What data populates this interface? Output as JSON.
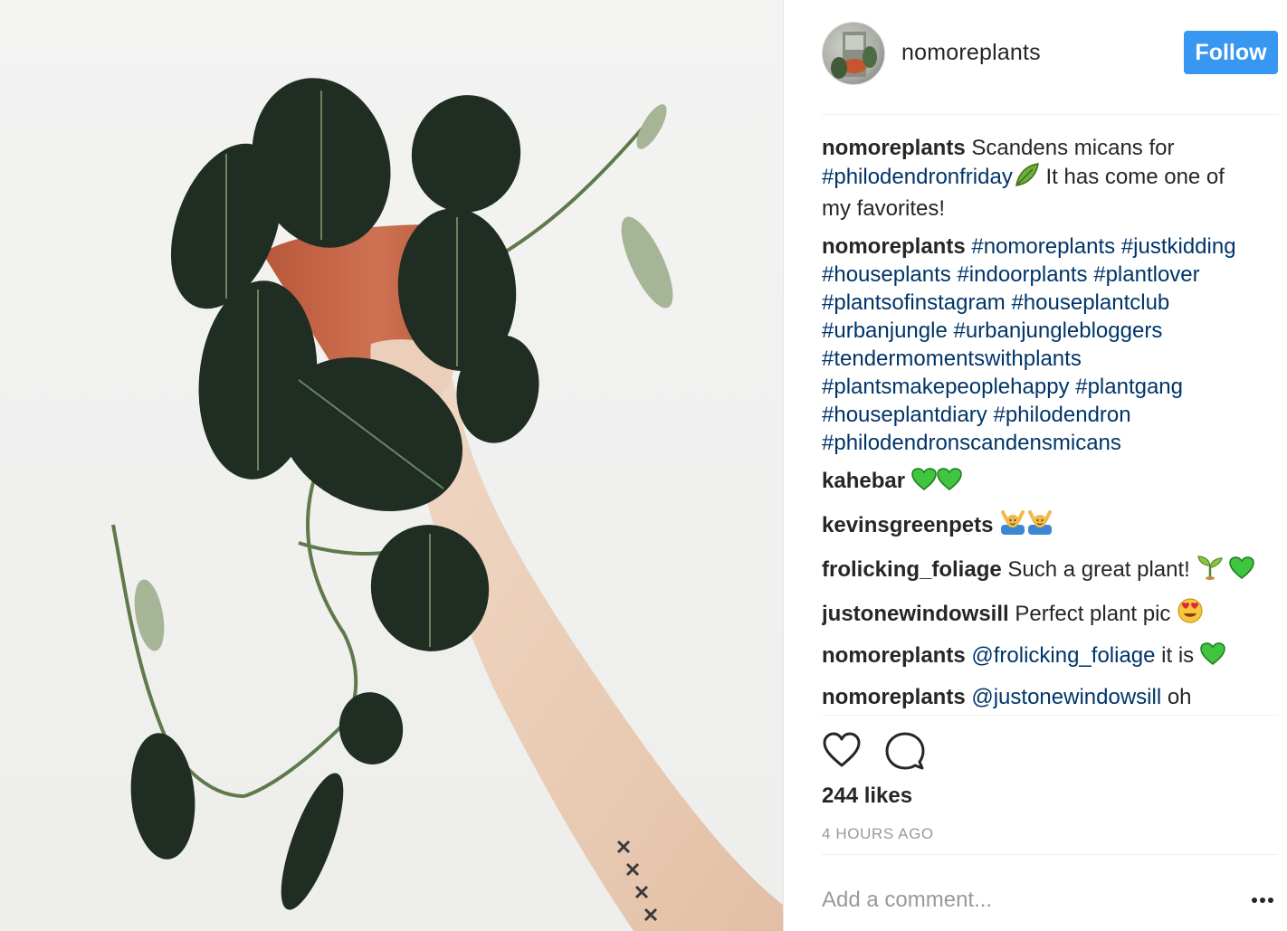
{
  "post": {
    "username": "nomoreplants",
    "follow_label": "Follow",
    "comments": [
      {
        "user": "nomoreplants",
        "parts": [
          {
            "type": "text",
            "value": " Scandens micans for "
          },
          {
            "type": "tag",
            "value": "#philodendronfriday"
          },
          {
            "type": "emoji",
            "value": "leaf"
          },
          {
            "type": "text",
            "value": " It has come one of my favorites!"
          }
        ]
      },
      {
        "user": "nomoreplants",
        "parts": [
          {
            "type": "text",
            "value": " "
          },
          {
            "type": "tag",
            "value": "#nomoreplants"
          },
          {
            "type": "text",
            "value": " "
          },
          {
            "type": "tag",
            "value": "#justkidding"
          },
          {
            "type": "text",
            "value": " "
          },
          {
            "type": "tag",
            "value": "#houseplants"
          },
          {
            "type": "text",
            "value": " "
          },
          {
            "type": "tag",
            "value": "#indoorplants"
          },
          {
            "type": "text",
            "value": " "
          },
          {
            "type": "tag",
            "value": "#plantlover"
          },
          {
            "type": "text",
            "value": " "
          },
          {
            "type": "tag",
            "value": "#plantsofinstagram"
          },
          {
            "type": "text",
            "value": " "
          },
          {
            "type": "tag",
            "value": "#houseplantclub"
          },
          {
            "type": "text",
            "value": " "
          },
          {
            "type": "tag",
            "value": "#urbanjungle"
          },
          {
            "type": "text",
            "value": " "
          },
          {
            "type": "tag",
            "value": "#urbanjunglebloggers"
          },
          {
            "type": "text",
            "value": " "
          },
          {
            "type": "tag",
            "value": "#tendermomentswithplants"
          },
          {
            "type": "text",
            "value": " "
          },
          {
            "type": "tag",
            "value": "#plantsmakepeoplehappy"
          },
          {
            "type": "text",
            "value": " "
          },
          {
            "type": "tag",
            "value": "#plantgang"
          },
          {
            "type": "text",
            "value": " "
          },
          {
            "type": "tag",
            "value": "#houseplantdiary"
          },
          {
            "type": "text",
            "value": " "
          },
          {
            "type": "tag",
            "value": "#philodendron"
          },
          {
            "type": "text",
            "value": " "
          },
          {
            "type": "tag",
            "value": "#philodendronscandensmicans"
          }
        ]
      },
      {
        "user": "kahebar",
        "parts": [
          {
            "type": "text",
            "value": " "
          },
          {
            "type": "emoji",
            "value": "green-heart"
          },
          {
            "type": "emoji",
            "value": "green-heart"
          }
        ]
      },
      {
        "user": "kevinsgreenpets",
        "parts": [
          {
            "type": "text",
            "value": " "
          },
          {
            "type": "emoji",
            "value": "raising-hands-person"
          },
          {
            "type": "emoji",
            "value": "raising-hands-person"
          }
        ]
      },
      {
        "user": "frolicking_foliage",
        "parts": [
          {
            "type": "text",
            "value": " Such a great plant! "
          },
          {
            "type": "emoji",
            "value": "seedling"
          },
          {
            "type": "text",
            "value": " "
          },
          {
            "type": "emoji",
            "value": "green-heart"
          }
        ]
      },
      {
        "user": "justonewindowsill",
        "parts": [
          {
            "type": "text",
            "value": " Perfect plant pic "
          },
          {
            "type": "emoji",
            "value": "heart-eyes"
          }
        ]
      },
      {
        "user": "nomoreplants",
        "parts": [
          {
            "type": "text",
            "value": " "
          },
          {
            "type": "tag",
            "value": "@frolicking_foliage"
          },
          {
            "type": "text",
            "value": " it is "
          },
          {
            "type": "emoji",
            "value": "green-heart"
          }
        ]
      },
      {
        "user": "nomoreplants",
        "parts": [
          {
            "type": "text",
            "value": " "
          },
          {
            "type": "tag",
            "value": "@justonewindowsill"
          },
          {
            "type": "text",
            "value": " oh"
          }
        ]
      }
    ],
    "likes_text": "244 likes",
    "timestamp": "4 HOURS AGO",
    "add_comment_placeholder": "Add a comment...",
    "icons": {
      "like": "heart-outline-icon",
      "comment": "speech-bubble-icon",
      "more": "more-options-icon"
    },
    "colors": {
      "follow_button": "#3897f0",
      "hashtag": "#003569",
      "secondary_text": "#999999"
    }
  }
}
